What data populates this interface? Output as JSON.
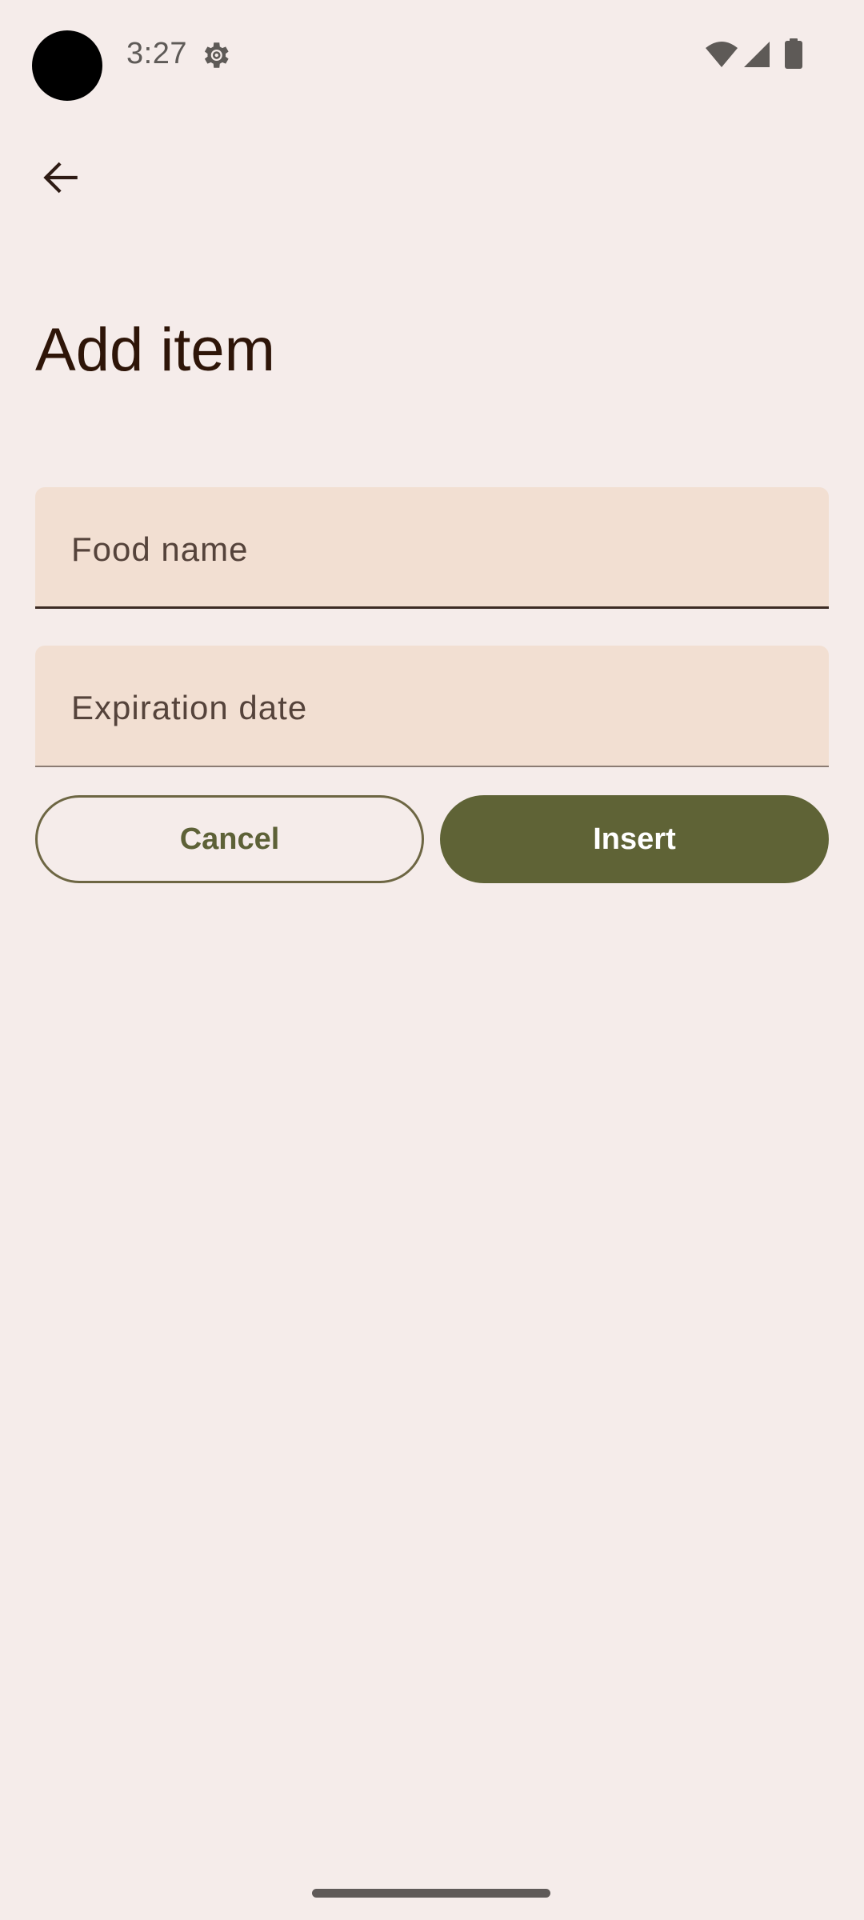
{
  "status_bar": {
    "time": "3:27",
    "icons": [
      "settings-gear-icon",
      "wifi-icon",
      "cellular-signal-icon",
      "battery-icon"
    ]
  },
  "toolbar": {
    "back_icon": "arrow-back-icon"
  },
  "page": {
    "title": "Add item"
  },
  "form": {
    "food_name": {
      "label": "Food name",
      "value": ""
    },
    "expiration_date": {
      "label": "Expiration date",
      "value": ""
    }
  },
  "actions": {
    "cancel_label": "Cancel",
    "insert_label": "Insert"
  },
  "colors": {
    "background": "#f5ecea",
    "field_fill": "#f2dfd2",
    "primary": "#5f6336",
    "title_text": "#2e1508"
  }
}
